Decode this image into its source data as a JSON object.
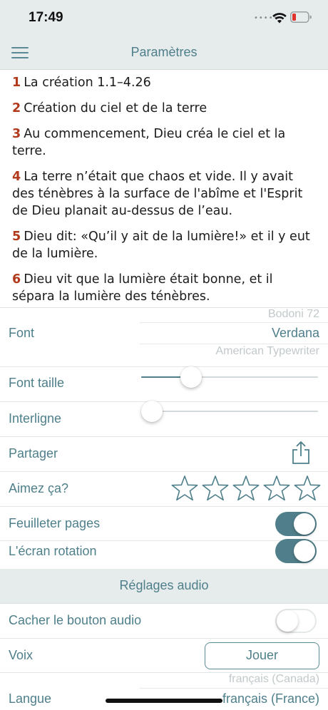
{
  "status_bar": {
    "time": "17:49",
    "dots": "•••••"
  },
  "nav": {
    "title": "Paramètres",
    "menu_icon": "hamburger-menu-icon"
  },
  "reading": {
    "verses": [
      {
        "num": "1",
        "text": "La création 1.1–4.26"
      },
      {
        "num": "2",
        "text": "Création du ciel et de la terre"
      },
      {
        "num": "3",
        "text": "Au commencement, Dieu créa le ciel et la terre."
      },
      {
        "num": "4",
        "text": "La terre n’était que chaos et vide. Il y avait des ténèbres à la surface de l'abîme et l'Esprit de Dieu planait au-dessus de l’eau."
      },
      {
        "num": "5",
        "text": "Dieu dit: «Qu’il y ait de la lumière!» et il y eut de la lumière."
      },
      {
        "num": "6",
        "text": "Dieu vit que la lumière était bonne, et il sépara la lumière des ténèbres."
      }
    ]
  },
  "settings": {
    "font": {
      "label": "Font",
      "options": [
        "Bodoni 72",
        "Verdana",
        "American Typewriter"
      ],
      "selected": "Verdana"
    },
    "font_size": {
      "label": "Font taille",
      "level": 0.25
    },
    "line_spacing": {
      "label": "Interligne",
      "level": 0.0
    },
    "share": {
      "label": "Partager",
      "icon": "share-icon"
    },
    "rate": {
      "label": "Aimez ça?",
      "stars": 5,
      "filled": 0,
      "icon": "star-outline-icon"
    },
    "page_curl": {
      "label": "Feuilleter pages",
      "on": true
    },
    "rotation": {
      "label": "L'écran rotation",
      "on": true
    },
    "audio_section": {
      "title": "Réglages audio"
    },
    "hide_audio": {
      "label": "Cacher le bouton audio",
      "on": false
    },
    "voice": {
      "label": "Voix",
      "button": "Jouer"
    },
    "language": {
      "label": "Langue",
      "options": [
        "français (Canada)",
        "français (France)"
      ],
      "selected": "français (France)"
    }
  },
  "colors": {
    "accent": "#4e7f8a",
    "verse_number": "#b23a1c",
    "header_bg": "#e6ebec",
    "toggle_on": "#507e8a"
  }
}
